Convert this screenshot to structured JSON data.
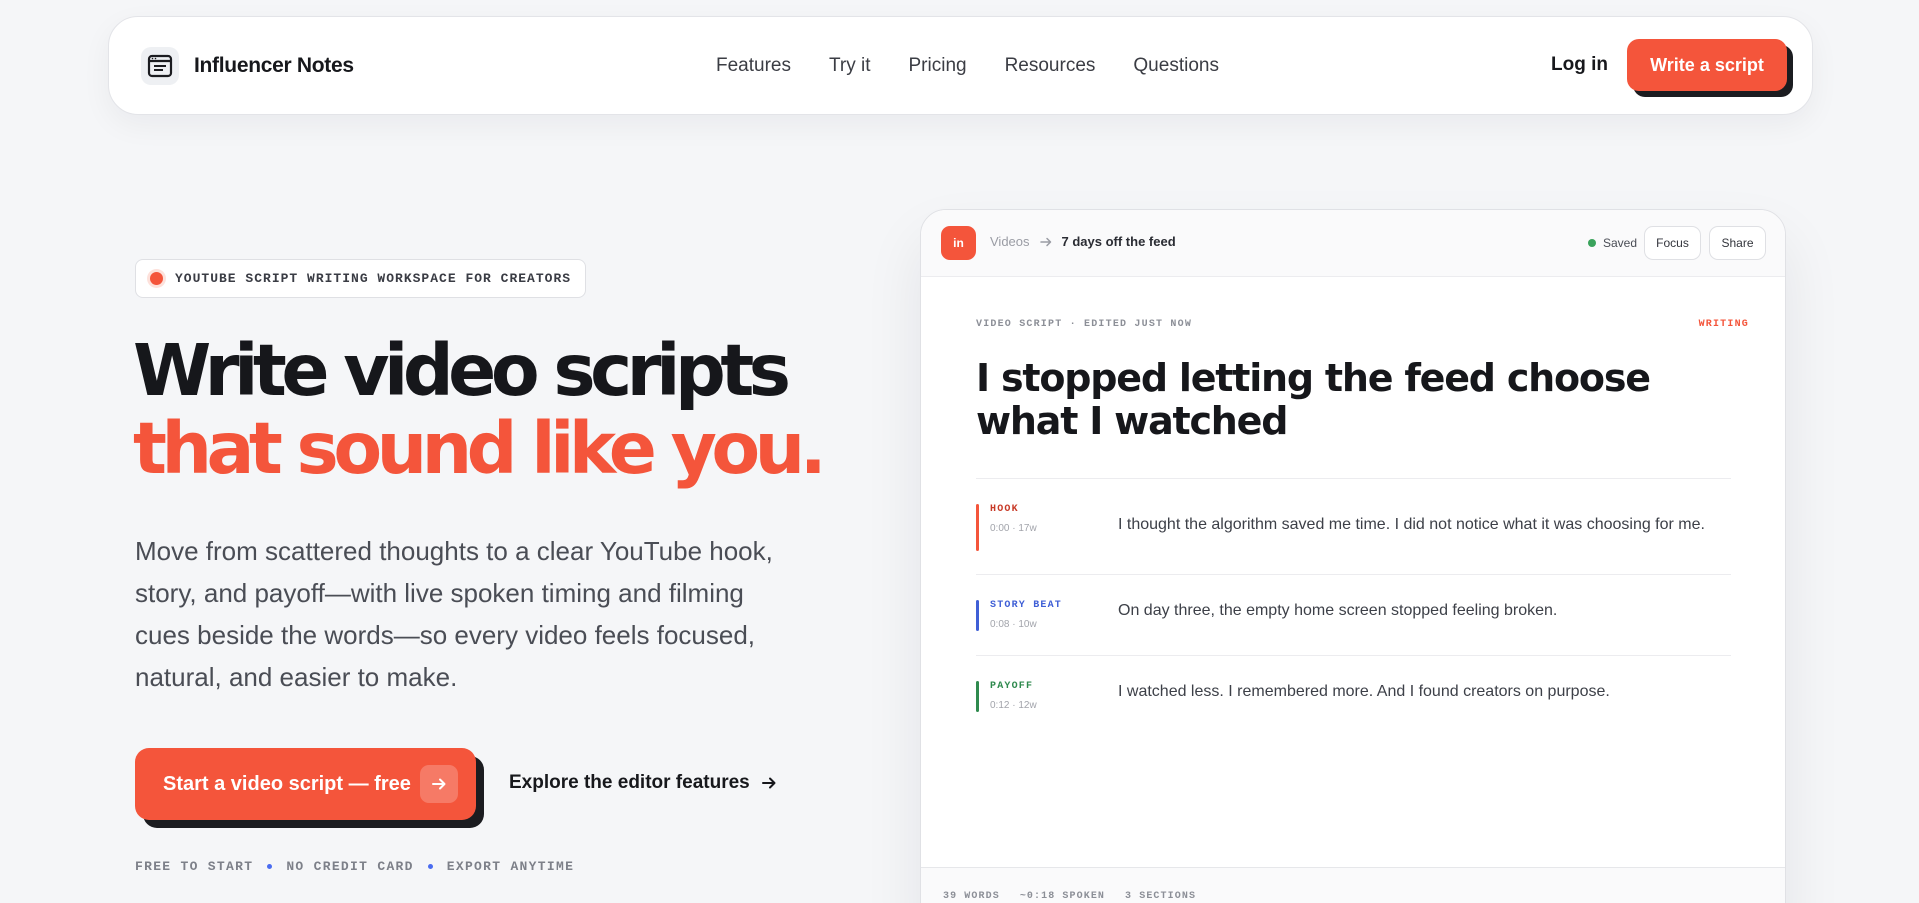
{
  "nav": {
    "brand": "Influencer Notes",
    "links": [
      "Features",
      "Try it",
      "Pricing",
      "Resources",
      "Questions"
    ],
    "login": "Log in",
    "cta": "Write a script"
  },
  "hero": {
    "eyebrow": "YOUTUBE SCRIPT WRITING WORKSPACE FOR CREATORS",
    "headline_line1": "Write video scripts",
    "headline_line2": "that sound like you.",
    "lead": "Move from scattered thoughts to a clear YouTube hook, story, and payoff—with live spoken timing and filming cues beside the words—so every video feels focused, natural, and easier to make.",
    "cta_primary": "Start a video script — free",
    "cta_secondary": "Explore the editor features",
    "perks": [
      "FREE TO START",
      "NO CREDIT CARD",
      "EXPORT ANYTIME"
    ]
  },
  "editor": {
    "logo": "in",
    "breadcrumb_parent": "Videos",
    "breadcrumb_current": "7 days off the feed",
    "saved": "Saved",
    "focus": "Focus",
    "share": "Share",
    "meta": "VIDEO SCRIPT · EDITED JUST NOW",
    "status": "WRITING",
    "title": "I stopped letting the feed choose what I watched",
    "sections": [
      {
        "label": "HOOK",
        "time": "0:00 · 17w",
        "text": "I thought the algorithm saved me time. I did not notice what it was choosing for me.",
        "color": "#c83a27"
      },
      {
        "label": "STORY BEAT",
        "time": "0:08 · 10w",
        "text": "On day three, the empty home screen stopped feeling broken.",
        "color": "#3f5fd6"
      },
      {
        "label": "PAYOFF",
        "time": "0:12 · 12w",
        "text": "I watched less. I remembered more. And I found creators on purpose.",
        "color": "#2f8a4e"
      }
    ],
    "footer": [
      "39 WORDS",
      "~0:18 SPOKEN",
      "3 SECTIONS"
    ]
  },
  "colors": {
    "accent": "#f4553b",
    "ink": "#1b1c20",
    "background": "#f5f6f8"
  }
}
